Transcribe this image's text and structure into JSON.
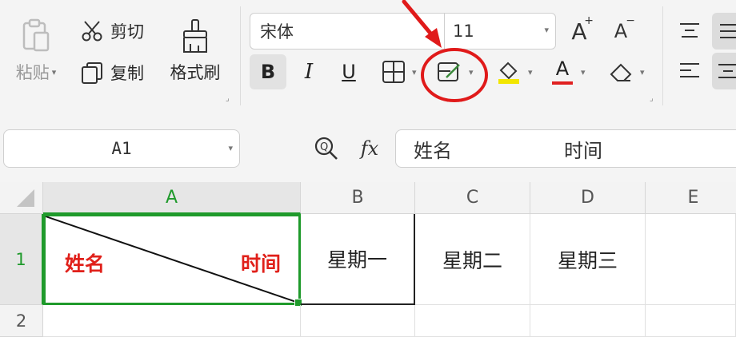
{
  "toolbar": {
    "paste_label": "粘贴",
    "cut_label": "剪切",
    "copy_label": "复制",
    "format_painter_label": "格式刷",
    "font_name": "宋体",
    "font_size": "11",
    "increase_font_label": "A",
    "decrease_font_label": "A",
    "bold_label": "B",
    "italic_label": "I",
    "underline_label": "U",
    "font_color_label": "A",
    "font_color": "#e02020",
    "highlight_color": "#f2e600",
    "annotation_color": "#e01a1a"
  },
  "formula_bar": {
    "cell_ref": "A1",
    "fx_label": "fx",
    "content_left": "姓名",
    "content_right": "时间"
  },
  "sheet": {
    "columns": [
      "A",
      "B",
      "C",
      "D",
      "E"
    ],
    "rows": [
      "1",
      "2"
    ],
    "a1_left": "姓名",
    "a1_right": "时间",
    "a1_text_color": "#e0201a",
    "selection_color": "#1f9a2b",
    "b1": "星期一",
    "c1": "星期二",
    "d1": "星期三"
  }
}
